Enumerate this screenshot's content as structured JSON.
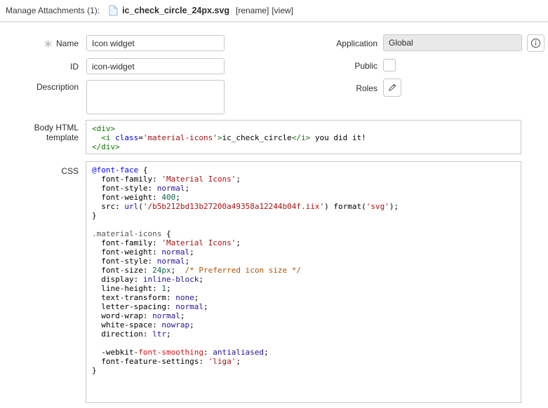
{
  "header": {
    "label": "Manage Attachments (1):",
    "filename": "ic_check_circle_24px.svg",
    "rename_link": "[rename]",
    "view_link": "[view]"
  },
  "form": {
    "name": {
      "label": "Name",
      "required": true,
      "value": "Icon widget"
    },
    "id": {
      "label": "ID",
      "value": "icon-widget"
    },
    "description": {
      "label": "Description",
      "value": ""
    },
    "application": {
      "label": "Application",
      "value": "Global",
      "readonly": true
    },
    "public": {
      "label": "Public",
      "checked": false
    },
    "roles": {
      "label": "Roles"
    }
  },
  "body_html": {
    "label": "Body HTML template",
    "code": [
      [
        [
          "tag",
          "<div>"
        ]
      ],
      [
        [
          "plain",
          "  "
        ],
        [
          "tag",
          "<i"
        ],
        [
          "plain",
          " "
        ],
        [
          "attr",
          "class"
        ],
        [
          "plain",
          "="
        ],
        [
          "string",
          "'material-icons'"
        ],
        [
          "tag",
          ">"
        ],
        [
          "plain",
          "ic_check_circle"
        ],
        [
          "tag",
          "</i>"
        ],
        [
          "plain",
          " you did it!"
        ]
      ],
      [
        [
          "tag",
          "</div>"
        ]
      ]
    ]
  },
  "css": {
    "label": "CSS",
    "code": [
      [
        [
          "def",
          "@font-face"
        ],
        [
          "plain",
          " {"
        ]
      ],
      [
        [
          "plain",
          "  "
        ],
        [
          "prop",
          "font-family"
        ],
        [
          "plain",
          ": "
        ],
        [
          "string",
          "'Material Icons'"
        ],
        [
          "plain",
          ";"
        ]
      ],
      [
        [
          "plain",
          "  "
        ],
        [
          "prop",
          "font-style"
        ],
        [
          "plain",
          ": "
        ],
        [
          "atom",
          "normal"
        ],
        [
          "plain",
          ";"
        ]
      ],
      [
        [
          "plain",
          "  "
        ],
        [
          "prop",
          "font-weight"
        ],
        [
          "plain",
          ": "
        ],
        [
          "number",
          "400"
        ],
        [
          "plain",
          ";"
        ]
      ],
      [
        [
          "plain",
          "  "
        ],
        [
          "prop",
          "src"
        ],
        [
          "plain",
          ": "
        ],
        [
          "atom",
          "url"
        ],
        [
          "plain",
          "("
        ],
        [
          "string",
          "'/b5b212bd13b27200a49358a12244b04f.iix'"
        ],
        [
          "plain",
          ") format("
        ],
        [
          "string",
          "'svg'"
        ],
        [
          "plain",
          ");"
        ]
      ],
      [
        [
          "plain",
          "}"
        ]
      ],
      [],
      [
        [
          "qualifier",
          ".material-icons"
        ],
        [
          "plain",
          " {"
        ]
      ],
      [
        [
          "plain",
          "  "
        ],
        [
          "prop",
          "font-family"
        ],
        [
          "plain",
          ": "
        ],
        [
          "string",
          "'Material Icons'"
        ],
        [
          "plain",
          ";"
        ]
      ],
      [
        [
          "plain",
          "  "
        ],
        [
          "prop",
          "font-weight"
        ],
        [
          "plain",
          ": "
        ],
        [
          "atom",
          "normal"
        ],
        [
          "plain",
          ";"
        ]
      ],
      [
        [
          "plain",
          "  "
        ],
        [
          "prop",
          "font-style"
        ],
        [
          "plain",
          ": "
        ],
        [
          "atom",
          "normal"
        ],
        [
          "plain",
          ";"
        ]
      ],
      [
        [
          "plain",
          "  "
        ],
        [
          "prop",
          "font-size"
        ],
        [
          "plain",
          ": "
        ],
        [
          "number",
          "24px"
        ],
        [
          "plain",
          ";  "
        ],
        [
          "comment",
          "/* Preferred icon size */"
        ]
      ],
      [
        [
          "plain",
          "  "
        ],
        [
          "prop",
          "display"
        ],
        [
          "plain",
          ": "
        ],
        [
          "atom",
          "inline-block"
        ],
        [
          "plain",
          ";"
        ]
      ],
      [
        [
          "plain",
          "  "
        ],
        [
          "prop",
          "line-height"
        ],
        [
          "plain",
          ": "
        ],
        [
          "number",
          "1"
        ],
        [
          "plain",
          ";"
        ]
      ],
      [
        [
          "plain",
          "  "
        ],
        [
          "prop",
          "text-transform"
        ],
        [
          "plain",
          ": "
        ],
        [
          "atom",
          "none"
        ],
        [
          "plain",
          ";"
        ]
      ],
      [
        [
          "plain",
          "  "
        ],
        [
          "prop",
          "letter-spacing"
        ],
        [
          "plain",
          ": "
        ],
        [
          "atom",
          "normal"
        ],
        [
          "plain",
          ";"
        ]
      ],
      [
        [
          "plain",
          "  "
        ],
        [
          "prop",
          "word-wrap"
        ],
        [
          "plain",
          ": "
        ],
        [
          "atom",
          "normal"
        ],
        [
          "plain",
          ";"
        ]
      ],
      [
        [
          "plain",
          "  "
        ],
        [
          "prop",
          "white-space"
        ],
        [
          "plain",
          ": "
        ],
        [
          "atom",
          "nowrap"
        ],
        [
          "plain",
          ";"
        ]
      ],
      [
        [
          "plain",
          "  "
        ],
        [
          "prop",
          "direction"
        ],
        [
          "plain",
          ": "
        ],
        [
          "atom",
          "ltr"
        ],
        [
          "plain",
          ";"
        ]
      ],
      [],
      [
        [
          "plain",
          "  -webkit-"
        ],
        [
          "error",
          "font-smoothing"
        ],
        [
          "plain",
          ": "
        ],
        [
          "atom",
          "antialiased"
        ],
        [
          "plain",
          ";"
        ]
      ],
      [
        [
          "plain",
          "  "
        ],
        [
          "prop",
          "font-feature-settings"
        ],
        [
          "plain",
          ": "
        ],
        [
          "string",
          "'liga'"
        ],
        [
          "plain",
          ";"
        ]
      ],
      [
        [
          "plain",
          "}"
        ]
      ],
      []
    ]
  },
  "syntax_colors": {
    "tag": "#117700",
    "attribute": "#0000cc",
    "string": "#aa1111",
    "atom": "#221199",
    "number": "#116644",
    "def": "#0000ff",
    "comment": "#aa5500",
    "qualifier": "#555555",
    "error": "#d11111"
  },
  "ui_colors": {
    "border": "#c9c9c9",
    "readonly_bg": "#e9e9e9",
    "divider": "#e2e2e2",
    "file_icon_blue": "#a8c8e8"
  }
}
